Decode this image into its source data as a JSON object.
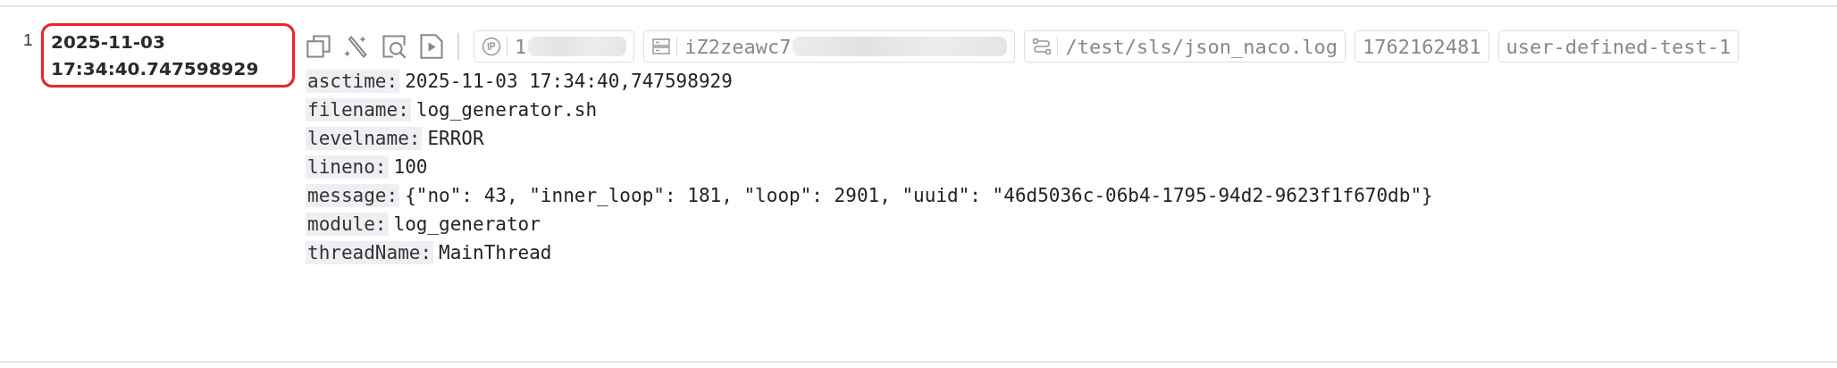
{
  "row_number": "1",
  "timestamp": {
    "date": "2025-11-03",
    "time": "17:34:40.747598929",
    "highlighted": true
  },
  "tags": [
    {
      "kind": "ip",
      "text": "1",
      "redacted": true
    },
    {
      "kind": "host",
      "text": "iZ2zeawc7",
      "redacted": true
    },
    {
      "kind": "path",
      "text": "/test/sls/json_naco.log",
      "redacted": false
    },
    {
      "kind": "plain",
      "text": "1762162481",
      "redacted": false
    },
    {
      "kind": "plain",
      "text": "user-defined-test-1",
      "redacted": false
    }
  ],
  "fields": [
    {
      "key": "asctime:",
      "value": "2025-11-03 17:34:40,747598929"
    },
    {
      "key": "filename:",
      "value": "log_generator.sh"
    },
    {
      "key": "levelname:",
      "value": "ERROR"
    },
    {
      "key": "lineno:",
      "value": "100"
    },
    {
      "key": "message:",
      "value": "{\"no\": 43, \"inner_loop\": 181, \"loop\": 2901, \"uuid\": \"46d5036c-06b4-1795-94d2-9623f1f670db\"}"
    },
    {
      "key": "module:",
      "value": "log_generator"
    },
    {
      "key": "threadName:",
      "value": "MainThread"
    }
  ]
}
